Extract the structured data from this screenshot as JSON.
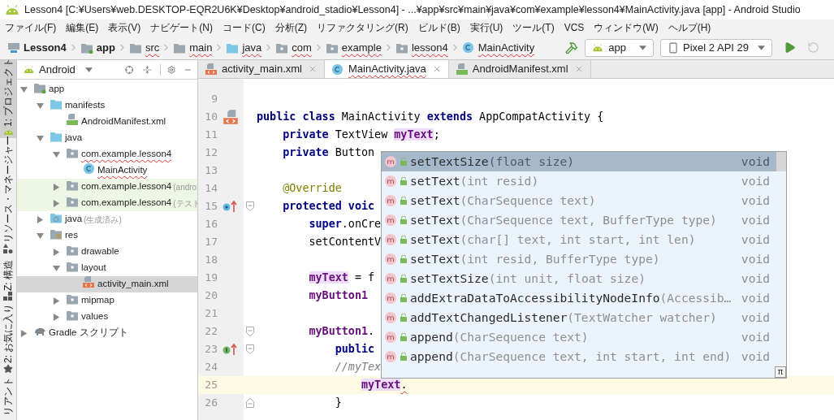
{
  "window": {
    "title": "Lesson4 [C:¥Users¥web.DESKTOP-EQR2U6K¥Desktop¥android_stadio¥Lesson4] - ...¥app¥src¥main¥java¥com¥example¥lesson4¥MainActivity.java [app] - Android Studio"
  },
  "menu": [
    "ファイル(F)",
    "編集(E)",
    "表示(V)",
    "ナビゲート(N)",
    "コード(C)",
    "分析(Z)",
    "リファクタリング(R)",
    "ビルド(B)",
    "実行(U)",
    "ツール(T)",
    "VCS",
    "ウィンドウ(W)",
    "ヘルプ(H)"
  ],
  "breadcrumbs": [
    {
      "label": "Lesson4",
      "kind": "project",
      "error": false
    },
    {
      "label": "app",
      "kind": "module",
      "error": false
    },
    {
      "label": "src",
      "kind": "folder",
      "error": true
    },
    {
      "label": "main",
      "kind": "folder",
      "error": true
    },
    {
      "label": "java",
      "kind": "source-folder",
      "error": true
    },
    {
      "label": "com",
      "kind": "package",
      "error": true
    },
    {
      "label": "example",
      "kind": "package",
      "error": true
    },
    {
      "label": "lesson4",
      "kind": "package",
      "error": true
    },
    {
      "label": "MainActivity",
      "kind": "class",
      "error": true
    }
  ],
  "toolbar": {
    "configuration": "app",
    "device": "Pixel 2 API 29",
    "apply_changes": {
      "disabled": true
    }
  },
  "tool_strip": [
    {
      "label": "1: プロジェクト",
      "kind": "project",
      "selected": true
    },
    {
      "label": "リソース・マネージャー",
      "kind": "resources",
      "selected": false
    },
    {
      "label": "Z: 構造",
      "kind": "structure",
      "selected": false
    },
    {
      "label": "2: お気に入り",
      "kind": "favorites",
      "selected": false
    },
    {
      "label": "リアント",
      "kind": "variants",
      "selected": false
    }
  ],
  "project_panel": {
    "view": "Android",
    "tree": [
      {
        "label": "app",
        "kind": "module",
        "expanded": true,
        "selected": false,
        "test": false,
        "error": false,
        "children": [
          {
            "label": "manifests",
            "kind": "source-folder",
            "expanded": true,
            "selected": false,
            "test": false,
            "error": false,
            "children": [
              {
                "label": "AndroidManifest.xml",
                "kind": "manifest",
                "selected": false,
                "test": false,
                "error": false
              }
            ]
          },
          {
            "label": "java",
            "kind": "source-folder",
            "expanded": true,
            "selected": false,
            "test": false,
            "error": false,
            "children": [
              {
                "label": "com.example.lesson4",
                "kind": "package",
                "expanded": true,
                "selected": false,
                "test": false,
                "error": true,
                "children": [
                  {
                    "label": "MainActivity",
                    "kind": "class",
                    "selected": false,
                    "test": false,
                    "error": true
                  }
                ]
              },
              {
                "label": "com.example.lesson4",
                "suffix": "(andro",
                "kind": "package",
                "expanded": false,
                "selected": false,
                "test": true,
                "error": false
              },
              {
                "label": "com.example.lesson4",
                "suffix": "(テスト",
                "kind": "package",
                "expanded": false,
                "selected": false,
                "test": true,
                "error": false
              }
            ]
          },
          {
            "label": "java",
            "suffix": "(生成済み)",
            "kind": "generated-folder",
            "expanded": false,
            "selected": false,
            "test": false,
            "error": false
          },
          {
            "label": "res",
            "kind": "resource-folder",
            "expanded": true,
            "selected": false,
            "test": false,
            "error": false,
            "children": [
              {
                "label": "drawable",
                "kind": "package",
                "expanded": false,
                "selected": false,
                "test": false,
                "error": false
              },
              {
                "label": "layout",
                "kind": "package",
                "expanded": true,
                "selected": false,
                "test": false,
                "error": false,
                "children": [
                  {
                    "label": "activity_main.xml",
                    "kind": "xml",
                    "selected": true,
                    "test": false,
                    "error": false
                  }
                ]
              },
              {
                "label": "mipmap",
                "kind": "package",
                "expanded": false,
                "selected": false,
                "test": false,
                "error": false
              },
              {
                "label": "values",
                "kind": "package",
                "expanded": false,
                "selected": false,
                "test": false,
                "error": false
              }
            ]
          }
        ]
      },
      {
        "label": "Gradle スクリプト",
        "kind": "gradle",
        "expanded": false,
        "selected": false,
        "test": false,
        "error": false
      }
    ]
  },
  "editor": {
    "tabs": [
      {
        "label": "activity_main.xml",
        "kind": "xml",
        "selected": false,
        "error": false
      },
      {
        "label": "MainActivity.java",
        "kind": "class",
        "selected": true,
        "error": true
      },
      {
        "label": "AndroidManifest.xml",
        "kind": "manifest",
        "selected": false,
        "error": false
      }
    ],
    "lines": [
      {
        "number": "9",
        "current": false
      },
      {
        "number": "10",
        "current": false,
        "gutter_icon": {
          "kind": "layout"
        },
        "tokens": [
          {
            "text": "public class",
            "kind": "keyword"
          },
          {
            "text": " MainActivity ",
            "kind": "plain"
          },
          {
            "text": "extends",
            "kind": "keyword"
          },
          {
            "text": " AppCompatActivity {",
            "kind": "plain"
          }
        ]
      },
      {
        "number": "11",
        "current": false,
        "tokens": [
          {
            "text": "    private",
            "kind": "keyword"
          },
          {
            "text": " TextView ",
            "kind": "plain"
          },
          {
            "text": "myText",
            "kind": "field",
            "highlight": true
          },
          {
            "text": ";",
            "kind": "plain"
          }
        ]
      },
      {
        "number": "12",
        "current": false,
        "tokens": [
          {
            "text": "    private",
            "kind": "keyword"
          },
          {
            "text": " Button",
            "kind": "plain"
          }
        ]
      },
      {
        "number": "13",
        "current": false
      },
      {
        "number": "14",
        "current": false,
        "tokens": [
          {
            "text": "    @Override",
            "kind": "annotation"
          }
        ]
      },
      {
        "number": "15",
        "current": false,
        "gutter_icon": {
          "kind": "override"
        },
        "fold_marker": {
          "kind": "start"
        },
        "tokens": [
          {
            "text": "    protected voic",
            "kind": "keyword"
          }
        ]
      },
      {
        "number": "16",
        "current": false,
        "tokens": [
          {
            "text": "        super",
            "kind": "keyword"
          },
          {
            "text": ".onCre",
            "kind": "plain"
          }
        ]
      },
      {
        "number": "17",
        "current": false,
        "tokens": [
          {
            "text": "        setContentV",
            "kind": "plain"
          }
        ]
      },
      {
        "number": "18",
        "current": false
      },
      {
        "number": "19",
        "current": false,
        "tokens": [
          {
            "text": "        myText",
            "kind": "field",
            "highlight": true
          },
          {
            "text": " = f",
            "kind": "plain"
          }
        ]
      },
      {
        "number": "20",
        "current": false,
        "tokens": [
          {
            "text": "        myButton1",
            "kind": "field"
          }
        ]
      },
      {
        "number": "21",
        "current": false
      },
      {
        "number": "22",
        "current": false,
        "fold_marker": {
          "kind": "start"
        },
        "tokens": [
          {
            "text": "        myButton1",
            "kind": "field"
          },
          {
            "text": ".",
            "kind": "plain"
          }
        ]
      },
      {
        "number": "23",
        "current": false,
        "gutter_icon": {
          "kind": "implement"
        },
        "fold_marker": {
          "kind": "start"
        },
        "tokens": [
          {
            "text": "            public",
            "kind": "keyword"
          }
        ]
      },
      {
        "number": "24",
        "current": false,
        "tokens": [
          {
            "text": "            //myTex",
            "kind": "comment"
          }
        ]
      },
      {
        "number": "25",
        "current": true,
        "tokens": [
          {
            "text": "                myText",
            "kind": "field",
            "highlight": true
          },
          {
            "text": ".",
            "kind": "plain",
            "error": true
          }
        ]
      },
      {
        "number": "26",
        "current": false,
        "fold_marker": {
          "kind": "end"
        },
        "tokens": [
          {
            "text": "            }",
            "kind": "plain"
          }
        ]
      }
    ],
    "completion": {
      "items": [
        {
          "name": "setTextSize",
          "params": "(float size)",
          "type": "void",
          "selected": true
        },
        {
          "name": "setText",
          "params": "(int resid)",
          "type": "void",
          "selected": false
        },
        {
          "name": "setText",
          "params": "(CharSequence text)",
          "type": "void",
          "selected": false
        },
        {
          "name": "setText",
          "params": "(CharSequence text, BufferType type)",
          "type": "void",
          "selected": false
        },
        {
          "name": "setText",
          "params": "(char[] text, int start, int len)",
          "type": "void",
          "selected": false
        },
        {
          "name": "setText",
          "params": "(int resid, BufferType type)",
          "type": "void",
          "selected": false
        },
        {
          "name": "setTextSize",
          "params": "(int unit, float size)",
          "type": "void",
          "selected": false
        },
        {
          "name": "addExtraDataToAccessibilityNodeInfo",
          "params": "(Accessib…",
          "type": "void",
          "selected": false
        },
        {
          "name": "addTextChangedListener",
          "params": "(TextWatcher watcher)",
          "type": "void",
          "selected": false
        },
        {
          "name": "append",
          "params": "(CharSequence text)",
          "type": "void",
          "selected": false
        },
        {
          "name": "append",
          "params": "(CharSequence text, int start, int end)",
          "type": "void",
          "selected": false
        }
      ],
      "corner_button": "π"
    }
  }
}
